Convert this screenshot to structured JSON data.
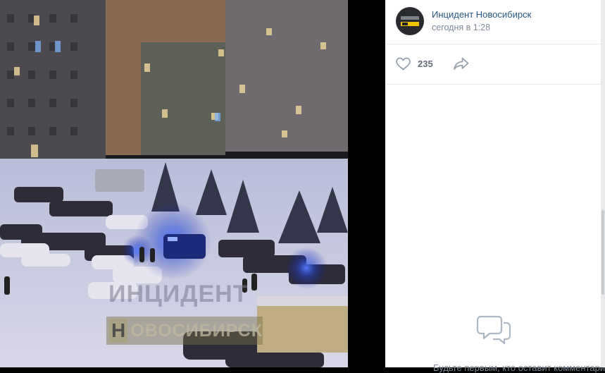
{
  "post": {
    "author": "Инцидент Новосибирск",
    "time": "сегодня в 1:28",
    "likes": "235"
  },
  "media": {
    "watermark_line1": "ИНЦИДЕНТ",
    "watermark_letter": "Н",
    "watermark_line2": "ОВОСИБИРСК"
  },
  "comments": {
    "empty_text": "Будьте первым, кто оставит комментарий"
  },
  "icons": {
    "like": "heart-icon",
    "share": "share-icon",
    "comments_empty": "speech-bubble-icon"
  },
  "colors": {
    "link": "#2a5885",
    "muted": "#818c99",
    "police_light": "#2f5bff"
  }
}
